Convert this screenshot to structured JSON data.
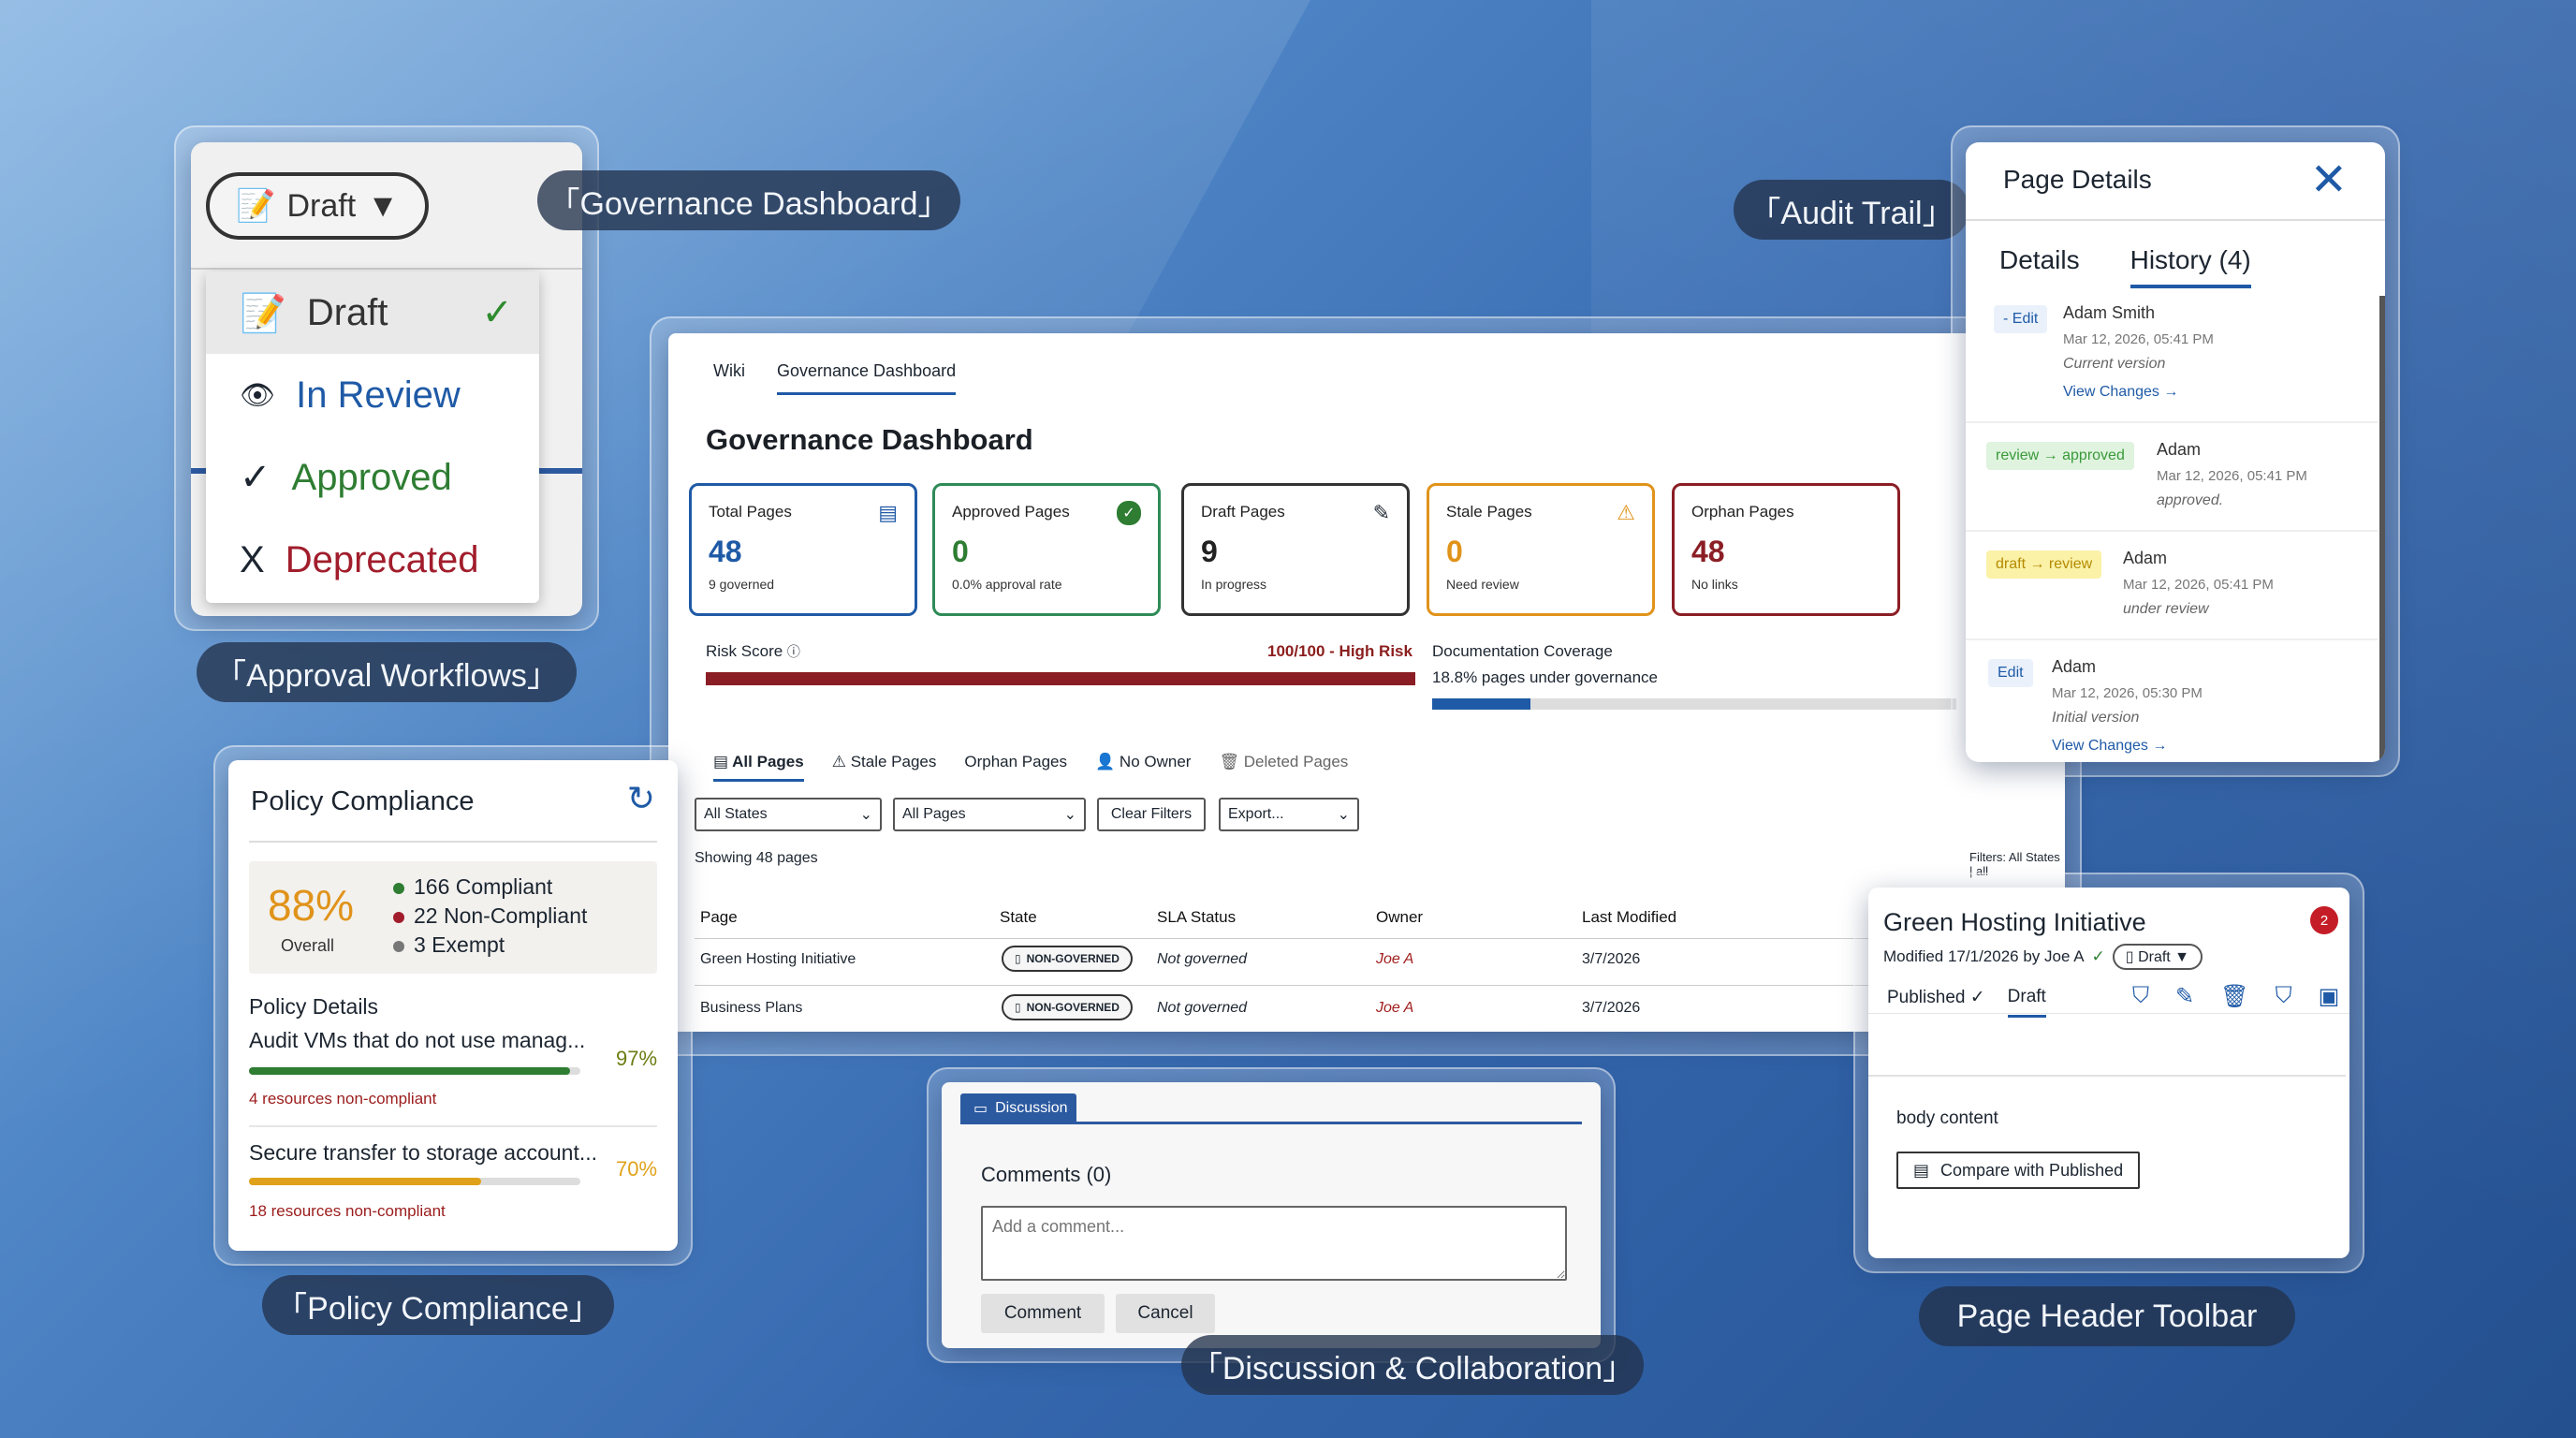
{
  "labels": {
    "governance": "「Governance Dashboard」",
    "audit": "「Audit Trail」",
    "approval": "「Approval Workflows」",
    "policy": "「Policy Compliance」",
    "discussion": "「Discussion & Collaboration」",
    "toolbar": "Page Header Toolbar"
  },
  "approval": {
    "selected": "Draft",
    "items": [
      {
        "label": "Draft",
        "color": "#333333",
        "icon": "draft-icon"
      },
      {
        "label": "In Review",
        "color": "#1f5aa6",
        "icon": "eye-icon"
      },
      {
        "label": "Approved",
        "color": "#2e7d32",
        "icon": "check-icon"
      },
      {
        "label": "Deprecated",
        "color": "#a11d2c",
        "icon": "x-icon"
      }
    ]
  },
  "dashboard": {
    "tabs": [
      "Wiki",
      "Governance Dashboard"
    ],
    "title": "Governance Dashboard",
    "stats": [
      {
        "label": "Total Pages",
        "value": "48",
        "sub": "9 governed",
        "color": "#1f5aa6",
        "icon": "document-icon"
      },
      {
        "label": "Approved Pages",
        "value": "0",
        "sub": "0.0% approval rate",
        "color": "#2e8b57",
        "icon": "check-circle-icon"
      },
      {
        "label": "Draft Pages",
        "value": "9",
        "sub": "In progress",
        "color": "#333333",
        "icon": "pencil-icon"
      },
      {
        "label": "Stale Pages",
        "value": "0",
        "sub": "Need review",
        "color": "#e0931a",
        "icon": "warning-icon"
      },
      {
        "label": "Orphan Pages",
        "value": "48",
        "sub": "No links",
        "color": "#8b1e25",
        "icon": ""
      }
    ],
    "risk_label": "Risk Score",
    "risk_value": "100/100 - High Risk",
    "risk_score": 100,
    "doc_label": "Documentation Coverage",
    "doc_sub": "18.8% pages under governance",
    "doc_pct": 18.8,
    "filter_tabs": [
      "All Pages",
      "Stale Pages",
      "Orphan Pages",
      "No Owner",
      "Deleted Pages"
    ],
    "controls": {
      "states": "All States",
      "pages": "All Pages",
      "clear": "Clear Filters",
      "export": "Export..."
    },
    "showing": "Showing 48 pages",
    "filters": "Filters: All States | all",
    "columns": [
      "Page",
      "State",
      "SLA Status",
      "Owner",
      "Last Modified"
    ],
    "rows": [
      {
        "page": "Green Hosting Initiative",
        "state": "NON-GOVERNED",
        "sla": "Not governed",
        "owner": "Joe A",
        "modified": "3/7/2026"
      },
      {
        "page": "Business Plans",
        "state": "NON-GOVERNED",
        "sla": "Not governed",
        "owner": "Joe A",
        "modified": "3/7/2026"
      }
    ]
  },
  "audit": {
    "title": "Page Details",
    "tabs": [
      "Details",
      "History (4)"
    ],
    "history": [
      {
        "tag": "- Edit",
        "name": "Adam Smith",
        "date": "Mar 12, 2026, 05:41 PM",
        "note": "Current version",
        "link": "View Changes →"
      },
      {
        "tag": "review → approved",
        "name": "Adam",
        "date": "Mar 12, 2026, 05:41 PM",
        "note": "approved.",
        "link": ""
      },
      {
        "tag": "draft → review",
        "name": "Adam",
        "date": "Mar 12, 2026, 05:41 PM",
        "note": "under review",
        "link": ""
      },
      {
        "tag": "Edit",
        "name": "Adam",
        "date": "Mar 12, 2026, 05:30 PM",
        "note": "Initial version",
        "link": "View Changes →"
      }
    ]
  },
  "policy": {
    "title": "Policy Compliance",
    "overall_pct": "88%",
    "overall_label": "Overall",
    "legend": [
      "166 Compliant",
      "22 Non-Compliant",
      "3 Exempt"
    ],
    "details_label": "Policy Details",
    "rows": [
      {
        "name": "Audit VMs that do not use manag...",
        "pct": "97%",
        "value": 97,
        "color": "#2e7d32",
        "warn": "4 resources non-compliant"
      },
      {
        "name": "Secure transfer to storage account...",
        "pct": "70%",
        "value": 70,
        "color": "#e0a21a",
        "warn": "18 resources non-compliant"
      }
    ]
  },
  "discussion": {
    "tab": "Discussion",
    "title": "Comments (0)",
    "placeholder": "Add a comment...",
    "comment_btn": "Comment",
    "cancel_btn": "Cancel"
  },
  "toolbar": {
    "title": "Green Hosting Initiative",
    "meta": "Modified 17/1/2026 by Joe A",
    "draft": "Draft ▼",
    "notif": "2",
    "tabs": [
      "Published ✓",
      "Draft"
    ],
    "body": "body content",
    "compare": "Compare with Published"
  }
}
